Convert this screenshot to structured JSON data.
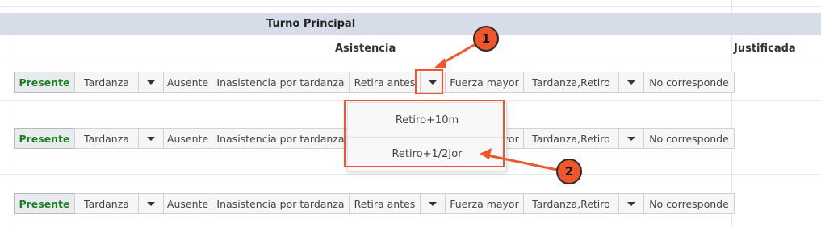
{
  "header": {
    "title": "Turno Principal"
  },
  "columns": {
    "asistencia": "Asistencia",
    "justificada": "Justificada"
  },
  "rows": [
    {
      "buttons": [
        {
          "label": "Presente",
          "active": true
        },
        {
          "label": "Tardanza"
        },
        {
          "label": "",
          "caret": true
        },
        {
          "label": "Ausente"
        },
        {
          "label": "Inasistencia por tardanza"
        },
        {
          "label": "Retira antes"
        },
        {
          "label": "",
          "caret": true,
          "highlight": true
        },
        {
          "label": "Fuerza mayor"
        },
        {
          "label": "Tardanza,Retiro"
        },
        {
          "label": "",
          "caret": true
        },
        {
          "label": "No corresponde"
        }
      ]
    },
    {
      "buttons": [
        {
          "label": "Presente",
          "active": true
        },
        {
          "label": "Tardanza"
        },
        {
          "label": "",
          "caret": true
        },
        {
          "label": "Ausente"
        },
        {
          "label": "Inasistencia por tardanza"
        },
        {
          "label": "Retira antes"
        },
        {
          "label": "",
          "caret": true
        },
        {
          "label": "Fuerza mayor"
        },
        {
          "label": "Tardanza,Retiro"
        },
        {
          "label": "",
          "caret": true
        },
        {
          "label": "No corresponde"
        }
      ]
    },
    {
      "buttons": [
        {
          "label": "Presente",
          "active": true
        },
        {
          "label": "Tardanza"
        },
        {
          "label": "",
          "caret": true
        },
        {
          "label": "Ausente"
        },
        {
          "label": "Inasistencia por tardanza"
        },
        {
          "label": "Retira antes"
        },
        {
          "label": "",
          "caret": true
        },
        {
          "label": "Fuerza mayor"
        },
        {
          "label": "Tardanza,Retiro"
        },
        {
          "label": "",
          "caret": true
        },
        {
          "label": "No corresponde"
        }
      ]
    }
  ],
  "dropdown": {
    "items": [
      "Retiro+10m",
      "Retiro+1/2Jor"
    ]
  },
  "annotations": {
    "badge1": "1",
    "badge2": "2",
    "color": "#f0562a"
  }
}
